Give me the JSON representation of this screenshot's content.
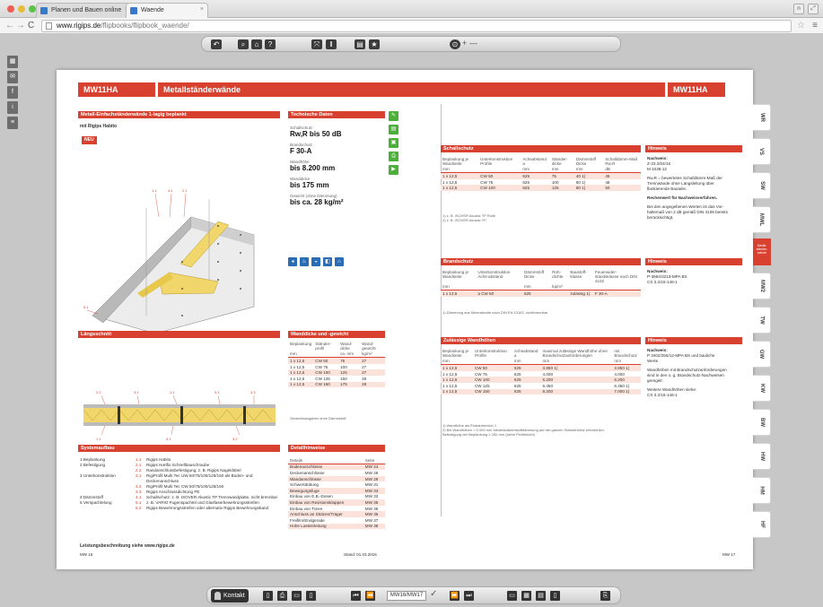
{
  "browser": {
    "tabs": [
      {
        "label": "Planen und Bauen online",
        "active": false
      },
      {
        "label": "Waende",
        "active": true
      }
    ],
    "url_host": "www.rigips.de",
    "url_path": "/flipbooks/flipbook_waende/"
  },
  "viewer": {
    "top_controls": [
      "undo-icon",
      "search-icon",
      "home-icon",
      "help-icon",
      "fullscreen-icon",
      "columns-icon",
      "list-icon",
      "bookmark-star-icon",
      "zoom-in-icon"
    ],
    "zoom_label": "+",
    "zoom_minus": "—",
    "left_rail": [
      "grid-icon",
      "mail-icon",
      "facebook-icon",
      "info-icon",
      "menu-icon"
    ],
    "bottom": {
      "kontakt": "Kontakt",
      "page_input": "MW16/MW17",
      "check": "✓"
    }
  },
  "document": {
    "header_left_code": "MW11HA",
    "header_title": "Metallständerwände",
    "header_right_code": "MW11HA",
    "left": {
      "section1_title": "Metall-Einfachständerwände 1-lagig beplankt",
      "with_sub": "mit Rigips Habito",
      "new_badge": "NEU",
      "section2_title": "Längsschnitt",
      "section3_title": "Systemaufbau",
      "system_items": [
        {
          "label": "1 Beplankung",
          "num": "1.1",
          "text": "Rigips Habito"
        },
        {
          "label": "2 Befestigung",
          "num": "2.1",
          "text": "Rigips Hartfix Schnellbauschraube"
        },
        {
          "label": "",
          "num": "2.2",
          "text": "Randanschlussbefestigung, z. B. Rigips Nageldübel"
        },
        {
          "label": "3 Unterkonstruktion",
          "num": "3.1",
          "text": "RigiProfil Multi Tec UW 50/75/100/125/150 als Boden- und Deckenanschluss"
        },
        {
          "label": "",
          "num": "3.2",
          "text": "RigiProfil Multi Tec CW 50/75/100/125/150"
        },
        {
          "label": "",
          "num": "3.3",
          "text": "Rigips Anschlussdichtung PE"
        },
        {
          "label": "4 Dämmstoff",
          "num": "4.1",
          "text": "Schallschutz: z. B. ISOVER Akustic TP Trennwandplatte, nicht brennbar"
        },
        {
          "label": "5 Verspachtelung",
          "num": "5.1",
          "text": "z. B. VARIO Fugenspachtel und Glasfaserbewehrungsstreifen"
        },
        {
          "label": "",
          "num": "5.2",
          "text": "Rigips Bewehrungsstreifen oder alternativ Rigips Bewehrungsband"
        }
      ],
      "footer_link": "Leistungsbeschreibung siehe www.rigips.de",
      "footer_page": "MW 16"
    },
    "mid": {
      "tech_title": "Technische Daten",
      "tech": [
        {
          "label": "Schallschutz",
          "value": "Rw,R bis 50 dB"
        },
        {
          "label": "Brandschutz",
          "value": "F 30-A"
        },
        {
          "label": "Wandhöhe",
          "value": "bis 8.200 mm"
        },
        {
          "label": "Wanddicke",
          "value": "bis 175 mm"
        },
        {
          "label": "Gewicht (ohne Dämmung)",
          "value": "bis ca. 28 kg/m²"
        }
      ],
      "thick_title": "Wanddicke und -gewicht",
      "thick_headers": [
        "Beplankung",
        "Ständer-profil",
        "Wand-dicke",
        "Wand-gewicht"
      ],
      "thick_units": [
        "mm",
        "",
        "ca. mm",
        "kg/m²"
      ],
      "thick_rows": [
        [
          "1 x 12,5",
          "CW 50",
          "75",
          "27"
        ],
        [
          "1 x 12,5",
          "CW 75",
          "100",
          "27"
        ],
        [
          "1 x 12,5",
          "CW 100",
          "125",
          "27"
        ],
        [
          "1 x 12,5",
          "CW 125",
          "150",
          "28"
        ],
        [
          "1 x 12,5",
          "CW 150",
          "175",
          "28"
        ]
      ],
      "thick_note": "Gewichtsangaben ohne Dämmstoff",
      "detail_title": "Detailhinweise",
      "detail_headers": [
        "Details",
        "Seite"
      ],
      "detail_rows": [
        [
          "Bodenanschlüsse",
          "MW 24"
        ],
        [
          "Deckenanschlüsse",
          "MW 26"
        ],
        [
          "Wandanschlüsse",
          "MW 29"
        ],
        [
          "Schwertdübung",
          "MW 31"
        ],
        [
          "Bewegungsfuge",
          "MW 33"
        ],
        [
          "Einbau von E.B.-Dosen",
          "MW 33"
        ],
        [
          "Einbau von Revisionsklappen",
          "MW 35"
        ],
        [
          "Einbau von Türen",
          "MW 35"
        ],
        [
          "Anschluss an Stützen/Träger",
          "MW 36"
        ],
        [
          "Freifilm/Endgerade",
          "MW 37"
        ],
        [
          "Hohe Lasteinleitung",
          "MW 38"
        ]
      ],
      "footer_date": "Stand: 01.03.2016"
    },
    "right": {
      "schall_title": "Schallschutz",
      "schall_headers": [
        "Beplankung je Wandseite",
        "Unterkonstruktion Profile",
        "Achsabstand a",
        "Ständer-dicke",
        "Dämmstoff Dicke",
        "Schalldämm-Maß Rw,R"
      ],
      "schall_units": [
        "mm",
        "",
        "mm",
        "mm",
        "mm",
        "dB"
      ],
      "schall_rows": [
        [
          "1 x 12,5",
          "CW 50",
          "625",
          "75",
          "40 1)",
          "45"
        ],
        [
          "1 x 12,5",
          "CW 75",
          "625",
          "100",
          "60 1)",
          "48"
        ],
        [
          "1 x 12,5",
          "CW 100",
          "625",
          "125",
          "80 1)",
          "50"
        ]
      ],
      "schall_notes": [
        "1) z. B. ISOVER Akustic TP Rolle",
        "2) z. B. ISOVER Akustic TP"
      ],
      "brand_title": "Brandschutz",
      "brand_headers": [
        "Beplankung je Wandseite",
        "Unterkonstruktion Achs-abstand",
        "Dämmstoff Dicke",
        "Roh-dichte",
        "Baustoff-klasse",
        "Feuerwider-standsklasse nach DIN 4102"
      ],
      "brand_units": [
        "mm",
        "",
        "mm",
        "kg/m³",
        "",
        ""
      ],
      "brand_rows": [
        [
          "1 x 12,5",
          "≥ CW 50",
          "625",
          "",
          "zulässig 1)",
          "F 30-A"
        ]
      ],
      "brand_notes": [
        "1) Dämmung aus Mineralwolle nach DIN EN 13162, nichtbrennbar"
      ],
      "height_title": "Zulässige Wandhöhen",
      "height_headers": [
        "Beplankung je Wandseite",
        "Unterkonstruktion Profile",
        "Achsabstand a",
        "maximal zulässige Wandhöhe ohne Brandschutzanforderungen",
        "mit Brandschutz"
      ],
      "height_units": [
        "mm",
        "",
        "mm",
        "mm",
        "mm"
      ],
      "height_rows": [
        [
          "1 x 12,5",
          "CW 50",
          "625",
          "3.850 1)",
          "3.850 1)"
        ],
        [
          "1 x 12,5",
          "CW 75",
          "625",
          "4.000",
          "4.000"
        ],
        [
          "1 x 12,5",
          "CW 100",
          "625",
          "5.200",
          "5.200"
        ],
        [
          "1 x 12,5",
          "CW 125",
          "625",
          "6.450",
          "6.450 1)"
        ],
        [
          "1 x 12,5",
          "CW 150",
          "625",
          "8.200",
          "7.000 1)"
        ]
      ],
      "height_notes": [
        "1) Wandhöhe als Einbaubereich 1",
        "2) Bei Wandhöhen > 5.000 mm Mindestdämmstoffdämmung auf der ganzen Ständerhöhe erforderlich.",
        "   Befestigung der Beplankung ≥ 250 mm (siehe Prüfbericht)"
      ],
      "hint1_title": "Hinweis",
      "hint1_lines": [
        "Nachweis:",
        "Z-23.2/04/16",
        "M 1038-12",
        "",
        "Rw,R = bewertetes Schalldämm-Maß der",
        "Trennwände ohne Längsleitung über",
        "flankierende Bauteile.",
        "",
        "Rechenwert für Nachweisverfahren.",
        "",
        "Bei den angegebenen Werten ist das Vor-",
        "haltemaß von 2 dB gemäß DIN 4109 bereits",
        "berücksichtigt."
      ],
      "hint2_title": "Hinweis",
      "hint2_lines": [
        "Nachweis:",
        "P-3954/3213-MPA BS",
        "CS 3.2/15-146-1"
      ],
      "hint3_title": "Hinweis",
      "hint3_lines": [
        "Nachweis:",
        "P 3402/256/12-MPA BS und bauliche",
        "Werte",
        "",
        "Wandhöhen mit Brandschutzanforderungen",
        "sind in den o. g. Brandschutz-Nachweisen",
        "geregelt.",
        "",
        "Weitere Wandhöhen siehe:",
        "CS 3.2/15-146-1"
      ],
      "footer_page": "MW 17"
    },
    "side_tabs": [
      "WR",
      "VS",
      "SW",
      "MWL",
      "MW1",
      "MW2",
      "TW",
      "GW",
      "KW",
      "BW",
      "HW",
      "HM",
      "HF"
    ],
    "side_active": "MW1",
    "side_banner": "Metall­ständer­wände"
  },
  "colors": {
    "accent": "#d8412f",
    "green_icon": "#4caf3a",
    "blue_icon": "#2a6bb5",
    "row_shade": "#fbe3dc"
  }
}
